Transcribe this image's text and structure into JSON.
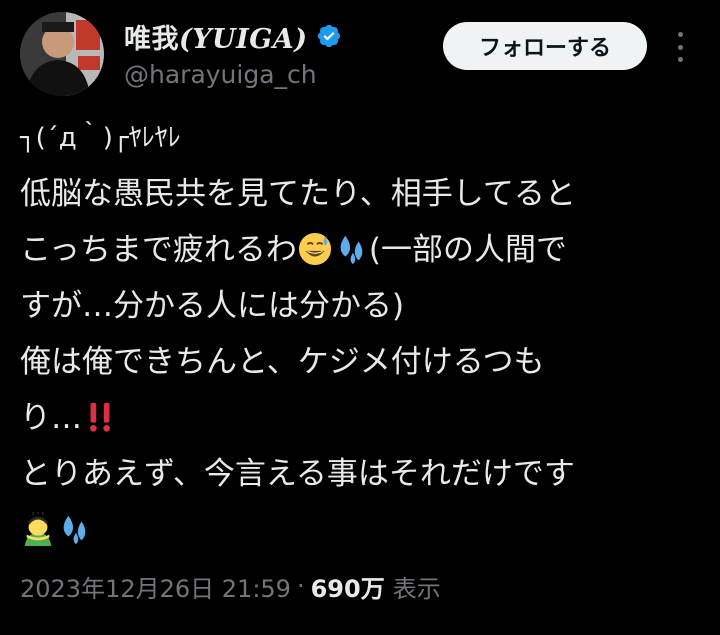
{
  "author": {
    "display_name_jp": "唯我",
    "display_name_latin": "(YUIGA)",
    "handle": "@harayuiga_ch",
    "verified": true,
    "verified_color": "#1d9bf0"
  },
  "actions": {
    "follow_label": "フォローする",
    "more_icon": "more-vertical-icon"
  },
  "tweet": {
    "line1_kaomoji": "┐(´д｀)┌ﾔﾚﾔﾚ",
    "line2": "低脳な愚民共を見てたり、相手してると",
    "line3_text": "こっちまで疲れるわ",
    "line3_emoji1": "grinning-sweat-emoji",
    "line3_emoji2": "sweat-droplets-emoji",
    "line3_tail": "(一部の人間で",
    "line4": "すが…分かる人には分かる)",
    "line5": "俺は俺できちんと、ケジメ付けるつも",
    "line6_text": "り…",
    "line6_emoji": "double-exclamation-emoji",
    "line7": "とりあえず、今言える事はそれだけです",
    "line8_emoji1": "man-bowing-emoji",
    "line8_emoji2": "sweat-droplets-emoji"
  },
  "meta": {
    "timestamp": "2023年12月26日 21:59",
    "separator": "·",
    "views_count": "690万",
    "views_label": "表示"
  },
  "colors": {
    "background": "#000000",
    "text_primary": "#e7e9ea",
    "text_secondary": "#71767b",
    "button_bg": "#eff3f4",
    "button_text": "#0f1419"
  }
}
